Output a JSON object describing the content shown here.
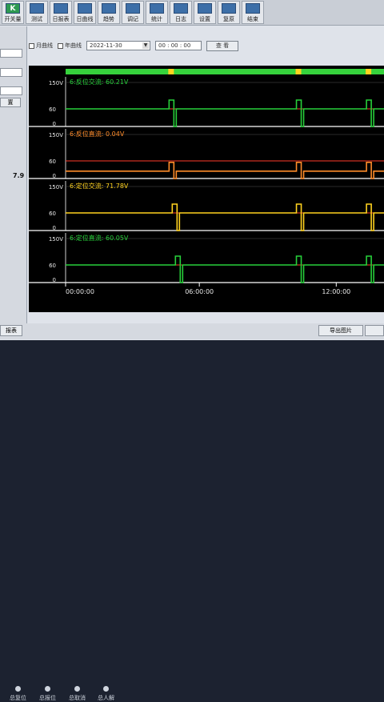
{
  "toolbar": {
    "buttons": [
      {
        "label": "开关量",
        "glyph": "K"
      },
      {
        "label": "测试",
        "glyph": ""
      },
      {
        "label": "日报表",
        "glyph": ""
      },
      {
        "label": "日曲线",
        "glyph": ""
      },
      {
        "label": "趋势",
        "glyph": ""
      },
      {
        "label": "调记",
        "glyph": ""
      },
      {
        "label": "统计",
        "glyph": ""
      },
      {
        "label": "日志",
        "glyph": ""
      },
      {
        "label": "设置",
        "glyph": ""
      },
      {
        "label": "复原",
        "glyph": ""
      },
      {
        "label": "结束",
        "glyph": ""
      }
    ]
  },
  "controls": {
    "month_curve": "月曲线",
    "year_curve": "年曲线",
    "date": "2022-11-30",
    "time": "00 : 00 : 00",
    "query": "查 看"
  },
  "left_panel": {
    "button": "置",
    "value_label": "7.9",
    "bottom_button": "报表"
  },
  "export_button": "导出图片",
  "bottom_buttons": [
    "总复位",
    "总报位",
    "总取消",
    "总人解"
  ],
  "chart_data": {
    "type": "line",
    "x_ticks": [
      "00:00:00",
      "06:00:00",
      "12:00:00"
    ],
    "panels": [
      {
        "title": "6:反位交流: 60.21V",
        "ymax_label": "150V",
        "ymid_label": "60",
        "ymin_label": "0",
        "color": "#27d03a",
        "title_color": "#27d03a",
        "base": 60,
        "pulses": [
          0.33,
          0.73,
          0.95
        ]
      },
      {
        "title": "6:反位直流: 0.04V",
        "ymax_label": "150V",
        "ymid_label": "60",
        "ymin_label": "0",
        "color": "#ff8c2a",
        "title_color": "#ff8c2a",
        "base": 25,
        "pulses": [
          0.33,
          0.73,
          0.95
        ]
      },
      {
        "title": "6:定位交流: 71.78V",
        "ymax_label": "150V",
        "ymid_label": "60",
        "ymin_label": "0",
        "color": "#ffd21f",
        "title_color": "#ffd21f",
        "base": 60,
        "pulses": [
          0.34,
          0.73,
          0.95
        ]
      },
      {
        "title": "6:定位直流: 60.05V",
        "ymax_label": "150V",
        "ymid_label": "60",
        "ymin_label": "0",
        "color": "#27d03a",
        "title_color": "#27d03a",
        "base": 60,
        "pulses": [
          0.35,
          0.73,
          0.95
        ]
      }
    ],
    "status_bar": {
      "markers": [
        0.33,
        0.73,
        0.95
      ]
    },
    "reference_value": 60,
    "reference_color": "#ff3a2a"
  }
}
